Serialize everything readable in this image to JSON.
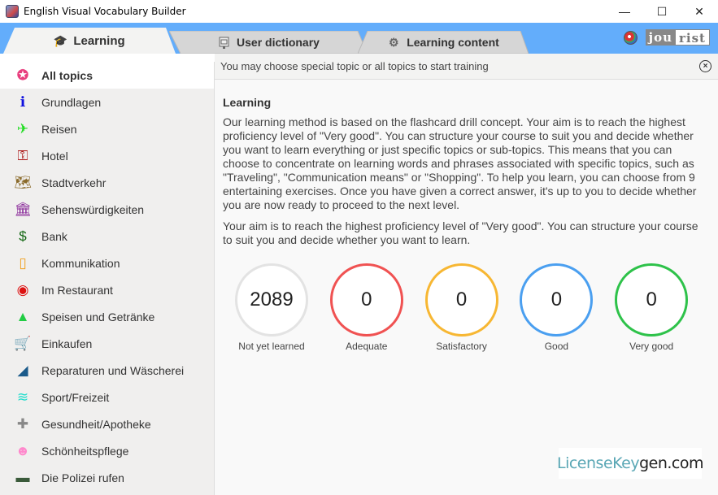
{
  "window": {
    "title": "English Visual Vocabulary Builder",
    "controls": {
      "minimize": "—",
      "maximize": "☐",
      "close": "✕"
    }
  },
  "tabs": [
    {
      "label": "Learning",
      "icon": "graduation-cap-icon",
      "active": true
    },
    {
      "label": "User dictionary",
      "icon": "book-icon",
      "active": false
    },
    {
      "label": "Learning content",
      "icon": "gear-icon",
      "active": false
    }
  ],
  "brand": {
    "logo_part1": "jou",
    "logo_part2": "rist"
  },
  "sidebar": {
    "items": [
      {
        "label": "All topics",
        "icon": "accessibility-icon",
        "color": "#e83e7e",
        "glyph": "✪",
        "active": true
      },
      {
        "label": "Grundlagen",
        "icon": "info-bubble-icon",
        "color": "#1010e0",
        "glyph": "ℹ"
      },
      {
        "label": "Reisen",
        "icon": "airplane-icon",
        "color": "#22dd22",
        "glyph": "✈"
      },
      {
        "label": "Hotel",
        "icon": "key-tag-icon",
        "color": "#aa1111",
        "glyph": "⚿"
      },
      {
        "label": "Stadtverkehr",
        "icon": "map-icon",
        "color": "#8a6a2a",
        "glyph": "🗺"
      },
      {
        "label": "Sehenswürdigkeiten",
        "icon": "temple-icon",
        "color": "#8a2a9a",
        "glyph": "🏛"
      },
      {
        "label": "Bank",
        "icon": "money-icon",
        "color": "#116611",
        "glyph": "$"
      },
      {
        "label": "Kommunikation",
        "icon": "mobile-phone-icon",
        "color": "#f0a020",
        "glyph": "▯"
      },
      {
        "label": "Im Restaurant",
        "icon": "plate-cutlery-icon",
        "color": "#dd1111",
        "glyph": "◉"
      },
      {
        "label": "Speisen und Getränke",
        "icon": "food-drink-icon",
        "color": "#22cc44",
        "glyph": "▲"
      },
      {
        "label": "Einkaufen",
        "icon": "shopping-cart-icon",
        "color": "#6a1030",
        "glyph": "🛒"
      },
      {
        "label": "Reparaturen und Wäscherei",
        "icon": "iron-icon",
        "color": "#1a5a8a",
        "glyph": "◢"
      },
      {
        "label": "Sport/Freizeit",
        "icon": "swimming-pool-icon",
        "color": "#22ddcc",
        "glyph": "≋"
      },
      {
        "label": "Gesundheit/Apotheke",
        "icon": "first-aid-kit-icon",
        "color": "#888888",
        "glyph": "✚"
      },
      {
        "label": "Schönheitspflege",
        "icon": "face-icon",
        "color": "#ff88cc",
        "glyph": "☻"
      },
      {
        "label": "Die Polizei rufen",
        "icon": "police-car-icon",
        "color": "#3a5a3a",
        "glyph": "▬"
      }
    ]
  },
  "infobar": {
    "text": "You may choose special topic or all topics to start training"
  },
  "content": {
    "heading": "Learning",
    "paragraph1": "Our learning method is based on the flashcard drill concept. Your aim is to reach the highest proficiency level of \"Very good\". You can structure your course to suit you and decide whether you want to learn everything or just specific topics or sub-topics. This means that you can choose to concentrate on learning words and phrases associated with specific topics, such as \"Traveling\", \"Communication means\" or \"Shopping\". To help you learn, you can choose from 9 entertaining exercises. Once you have given a correct answer, it's up to you to decide whether you are now ready to proceed to the next level.",
    "paragraph2": "Your aim is to reach the highest proficiency level of \"Very good\". You can structure your course to suit you and decide whether you want to learn."
  },
  "stats": [
    {
      "value": "2089",
      "label": "Not yet learned",
      "color": "#e3e3e3"
    },
    {
      "value": "0",
      "label": "Adequate",
      "color": "#f05252"
    },
    {
      "value": "0",
      "label": "Satisfactory",
      "color": "#f7b733"
    },
    {
      "value": "0",
      "label": "Good",
      "color": "#4a9ff0"
    },
    {
      "value": "0",
      "label": "Very good",
      "color": "#2ec24a"
    }
  ],
  "watermark": {
    "part1": "LicenseKey",
    "part2": "gen.com"
  }
}
